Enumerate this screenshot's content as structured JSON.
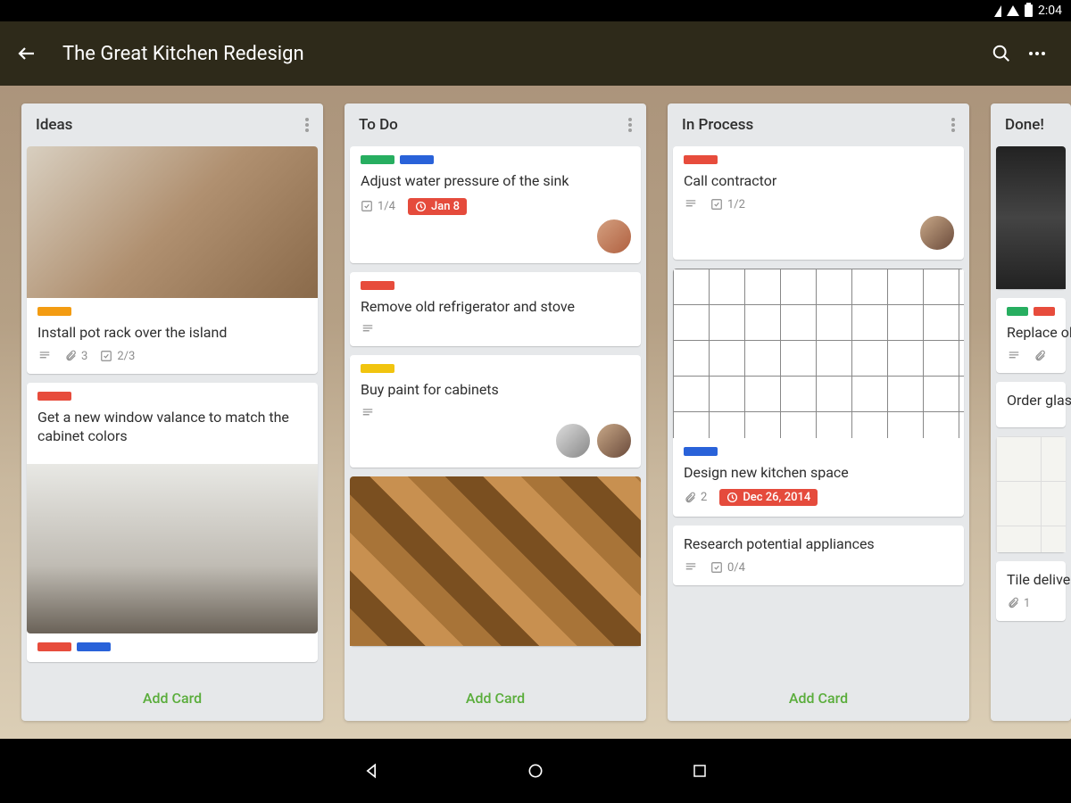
{
  "status": {
    "time": "2:04"
  },
  "app_bar": {
    "title": "The Great Kitchen Redesign"
  },
  "add_card_label": "Add Card",
  "lists": [
    {
      "name": "Ideas",
      "cards": [
        {
          "title": "Install pot rack over the island",
          "labels": [
            "orange"
          ],
          "cover": "kitchen",
          "badges": {
            "desc": true,
            "attachments": "3",
            "checklist": "2/3"
          }
        },
        {
          "title": "Get a new window valance to match the cabinet colors",
          "labels": [
            "red"
          ],
          "cover_below": "sink",
          "labels_below": [
            "red",
            "blue"
          ]
        }
      ]
    },
    {
      "name": "To Do",
      "cards": [
        {
          "title": "Adjust water pressure of the sink",
          "labels": [
            "green",
            "blue"
          ],
          "badges": {
            "checklist": "1/4",
            "due": "Jan 8"
          },
          "members": 1
        },
        {
          "title": "Remove old refrigerator and stove",
          "labels": [
            "red"
          ],
          "badges": {
            "desc": true
          }
        },
        {
          "title": "Buy paint for cabinets",
          "labels": [
            "yellow"
          ],
          "badges": {
            "desc": true
          },
          "members": 2,
          "cover_below": "floor"
        }
      ]
    },
    {
      "name": "In Process",
      "cards": [
        {
          "title": "Call contractor",
          "labels": [
            "red"
          ],
          "badges": {
            "desc": true,
            "checklist": "1/2"
          },
          "members": 1
        },
        {
          "title": "Design new kitchen space",
          "labels": [
            "blue"
          ],
          "cover": "blueprint",
          "badges": {
            "attachments": "2",
            "due": "Dec 26, 2014"
          }
        },
        {
          "title": "Research potential appliances",
          "badges": {
            "desc": true,
            "checklist": "0/4"
          }
        }
      ]
    },
    {
      "name": "Done!",
      "cards": [
        {
          "cover": "dark"
        },
        {
          "title": "Replace old ones",
          "labels": [
            "green",
            "red"
          ],
          "badges": {
            "desc": true,
            "attachments": ""
          }
        },
        {
          "title": "Order glass"
        },
        {
          "cover": "tile"
        },
        {
          "title": "Tile delivered",
          "badges": {
            "attachments": "1"
          }
        }
      ]
    }
  ]
}
